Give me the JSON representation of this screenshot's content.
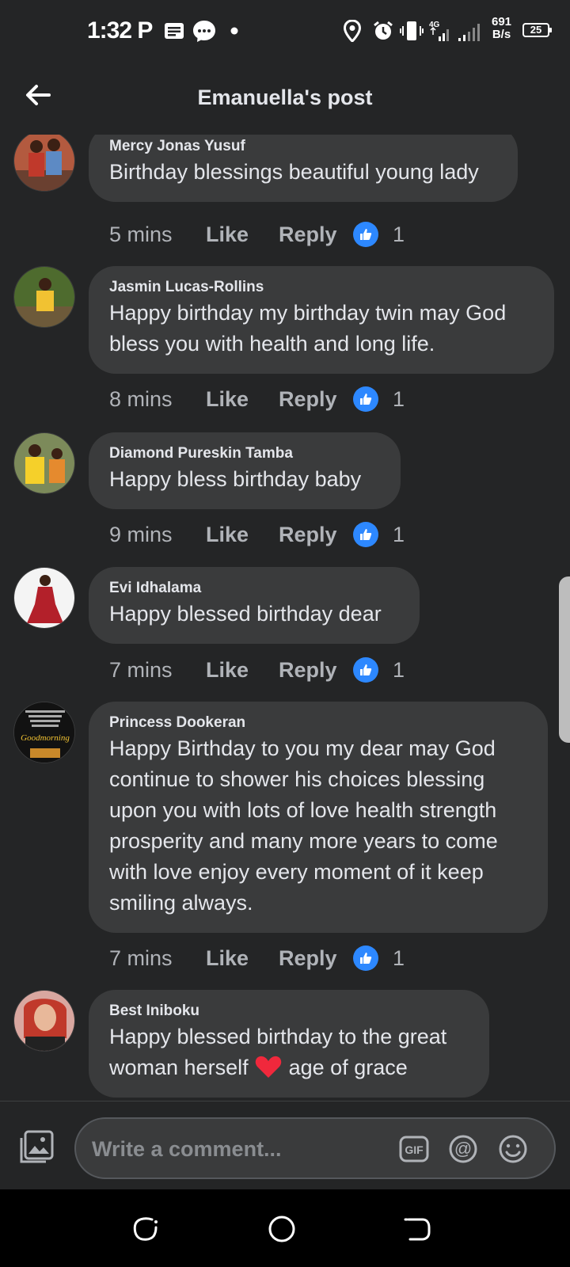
{
  "status_bar": {
    "time": "1:32",
    "ampm": "P",
    "network_speed_value": "691",
    "network_speed_unit": "B/s",
    "network_type": "4G",
    "battery_level": "25"
  },
  "header": {
    "title": "Emanuella's post"
  },
  "comments": [
    {
      "name": "Mercy Jonas Yusuf",
      "text": "Birthday blessings beautiful young lady",
      "time": "5 mins",
      "like_label": "Like",
      "reply_label": "Reply",
      "reaction_count": "1"
    },
    {
      "name": "Jasmin Lucas-Rollins",
      "text": "Happy birthday my birthday twin may God bless you with health and long life.",
      "time": "8 mins",
      "like_label": "Like",
      "reply_label": "Reply",
      "reaction_count": "1"
    },
    {
      "name": "Diamond Pureskin Tamba",
      "text": "Happy bless birthday baby",
      "time": "9 mins",
      "like_label": "Like",
      "reply_label": "Reply",
      "reaction_count": "1"
    },
    {
      "name": "Evi Idhalama",
      "text": "Happy blessed birthday dear",
      "time": "7 mins",
      "like_label": "Like",
      "reply_label": "Reply",
      "reaction_count": "1"
    },
    {
      "name": "Princess Dookeran",
      "text": "Happy Birthday to you my dear may God continue to shower his choices blessing upon you with lots of love health strength prosperity and many more years to come with love enjoy every moment of it keep smiling always.",
      "time": "7 mins",
      "like_label": "Like",
      "reply_label": "Reply",
      "reaction_count": "1",
      "avatar_caption": "Goodmorning"
    },
    {
      "name": "Best Iniboku",
      "text_before_emoji": "Happy blessed birthday to the great woman herself",
      "text_after_emoji": "age of grace",
      "emoji": "heart"
    }
  ],
  "composer": {
    "placeholder": "Write a comment...",
    "gif_label": "GIF",
    "mention_label": "@"
  },
  "icons": {
    "back": "arrow-left-icon",
    "reaction": "thumbs-up-icon",
    "photo": "photo-icon",
    "emoji": "emoji-icon"
  },
  "colors": {
    "background": "#242526",
    "bubble": "#3a3b3c",
    "like_blue": "#2d88ff",
    "heart_red": "#f0283c"
  }
}
